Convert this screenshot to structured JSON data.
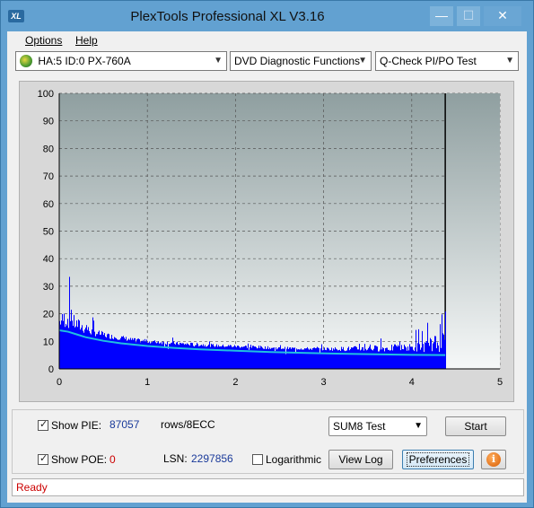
{
  "window": {
    "title": "PlexTools Professional XL V3.16",
    "app_icon": "XL",
    "controls": {
      "minimize": "—",
      "maximize": "☐",
      "close": "✕"
    }
  },
  "menu": {
    "options": "Options",
    "help": "Help"
  },
  "toolbar": {
    "drive": "HA:5 ID:0  PX-760A",
    "function": "DVD Diagnostic Functions",
    "test": "Q-Check PI/PO Test"
  },
  "chart_data": {
    "type": "bar",
    "xlim": [
      0,
      5
    ],
    "ylim": [
      0,
      100
    ],
    "x_ticks": [
      "0",
      "1",
      "2",
      "3",
      "4",
      "5"
    ],
    "y_ticks": [
      "0",
      "10",
      "20",
      "30",
      "40",
      "50",
      "60",
      "70",
      "80",
      "90",
      "100"
    ],
    "data_end_x": 4.38,
    "series": [
      {
        "kind": "bars",
        "color": "#0000ff",
        "x": [
          0.0,
          0.05,
          0.1,
          0.15,
          0.2,
          0.25,
          0.3,
          0.35,
          0.4,
          0.5,
          0.6,
          0.7,
          0.8,
          1.0,
          1.2,
          1.4,
          1.6,
          1.8,
          2.0,
          2.2,
          2.4,
          2.6,
          2.8,
          3.0,
          3.2,
          3.4,
          3.6,
          3.8,
          4.0,
          4.1,
          4.2,
          4.3,
          4.38
        ],
        "values": [
          26,
          33,
          35,
          30,
          27,
          25,
          22,
          20,
          18,
          17,
          15,
          15,
          13,
          12,
          12,
          11,
          11,
          10,
          10,
          10,
          9,
          9,
          9,
          9,
          10,
          11,
          12,
          13,
          14,
          16,
          18,
          26,
          27
        ]
      },
      {
        "kind": "line",
        "color": "#20c0e0",
        "x": [
          0.0,
          0.1,
          0.2,
          0.3,
          0.5,
          0.7,
          1.0,
          1.3,
          1.6,
          2.0,
          2.4,
          2.8,
          3.2,
          3.6,
          4.0,
          4.38
        ],
        "values": [
          14,
          13.5,
          12.5,
          11.5,
          10.2,
          9.3,
          8.3,
          7.6,
          7.1,
          6.6,
          6.1,
          5.8,
          5.5,
          5.3,
          5.1,
          5
        ]
      }
    ],
    "grid": true,
    "background": "gradient-gray"
  },
  "panel": {
    "show_pie_label": "Show PIE:",
    "show_pie_value": "87057",
    "rows_label": "rows/8ECC",
    "show_poe_label": "Show POE:",
    "show_poe_value": "0",
    "lsn_label": "LSN:",
    "lsn_value": "2297856",
    "log_label": "Logarithmic",
    "sum_select": "SUM8 Test",
    "start_button": "Start",
    "view_log_button": "View Log",
    "preferences_button": "Preferences",
    "info_icon": "i"
  },
  "status": {
    "text": "Ready"
  }
}
